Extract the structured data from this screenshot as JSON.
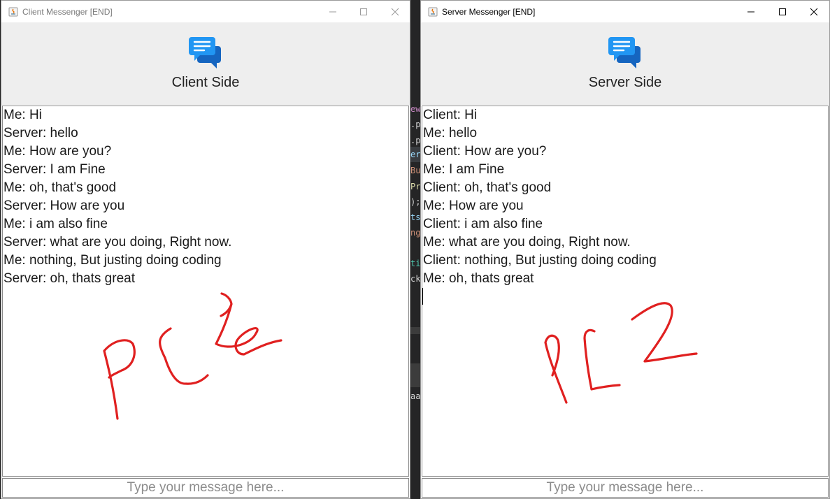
{
  "client": {
    "window_title": "Client Messenger [END]",
    "heading": "Client Side",
    "messages": [
      "Me: Hi",
      "Server: hello",
      "Me: How are you?",
      "Server: I am Fine",
      "Me: oh, that's good",
      "Server: How are you",
      "Me: i am also fine",
      "Server: what are you doing, Right now.",
      "Me: nothing, But justing doing coding",
      "Server: oh, thats great"
    ],
    "input_placeholder": "Type your message here...",
    "annotation": "PC1"
  },
  "server": {
    "window_title": "Server Messenger [END]",
    "heading": "Server Side",
    "messages": [
      "Client: Hi",
      "Me: hello",
      "Client: How are you?",
      "Me: I am Fine",
      "Client: oh, that's good",
      "Me: How are you",
      "Client: i am also fine",
      "Me: what are you doing, Right now.",
      "Client: nothing, But justing doing coding",
      "Me: oh, thats great"
    ],
    "input_placeholder": "Type your message here...",
    "annotation": "PC2"
  },
  "window_controls": [
    "minimize-icon",
    "maximize-icon",
    "close-icon"
  ],
  "colors": {
    "header_bg": "#eeeeee",
    "chat_icon": "#1e88e5",
    "annotation_ink": "#e02020"
  }
}
